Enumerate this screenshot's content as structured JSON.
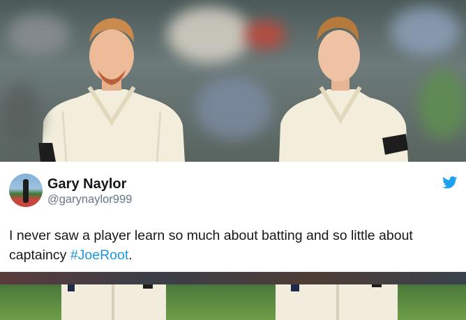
{
  "tweet": {
    "author_name": "Gary Naylor",
    "author_handle": "@garynaylor999",
    "text": "I never saw a player learn so much about batting and so little about captaincy ",
    "hashtag": "#JoeRoot",
    "text_end": "."
  },
  "icons": {
    "brand": "twitter-bird-icon"
  },
  "colors": {
    "link": "#1b95e0",
    "twitter_blue": "#1da1f2",
    "name": "#14171a",
    "handle": "#657786"
  }
}
